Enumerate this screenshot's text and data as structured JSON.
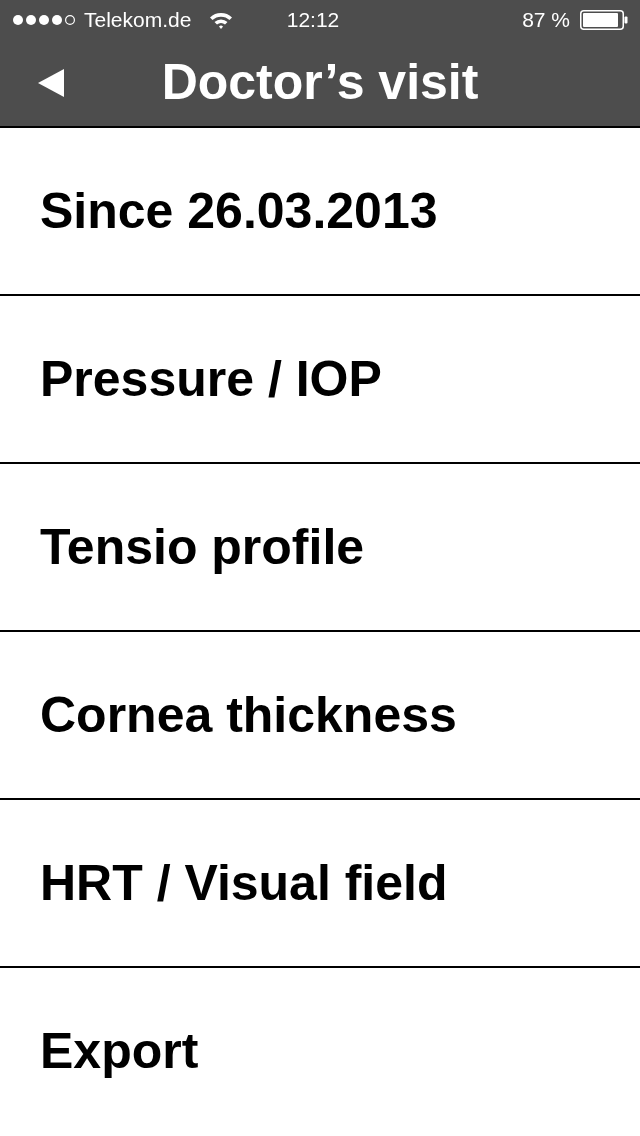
{
  "status_bar": {
    "carrier": "Telekom.de",
    "time": "12:12",
    "battery": "87 %"
  },
  "nav_bar": {
    "title": "Doctor’s visit"
  },
  "menu": [
    {
      "label": "Since 26.03.2013"
    },
    {
      "label": "Pressure / IOP"
    },
    {
      "label": "Tensio profile"
    },
    {
      "label": "Cornea thickness"
    },
    {
      "label": "HRT / Visual field"
    },
    {
      "label": "Export"
    }
  ]
}
